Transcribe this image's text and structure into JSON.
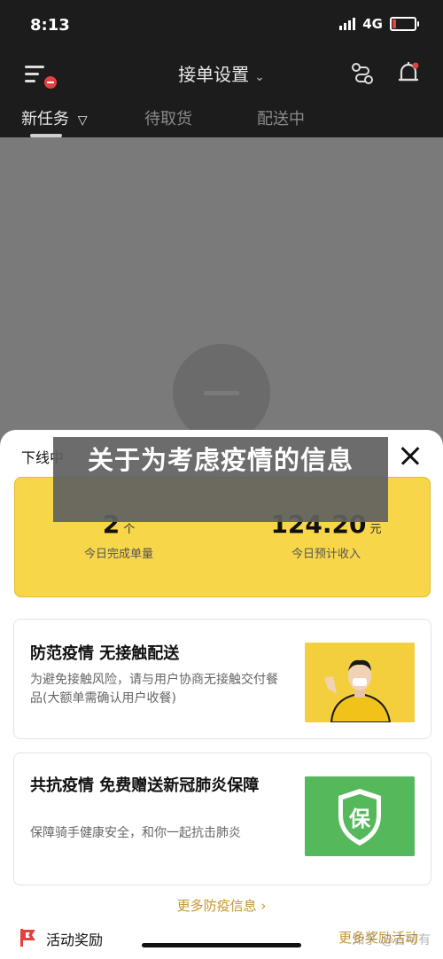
{
  "status_bar": {
    "time": "8:13",
    "network": "4G"
  },
  "header": {
    "title": "接单设置",
    "tabs": [
      "新任务",
      "待取货",
      "配送中"
    ],
    "active_tab": 0
  },
  "sheet": {
    "status_text": "下线中",
    "stats": [
      {
        "value": "2",
        "unit": "个",
        "label": "今日完成单量"
      },
      {
        "value": "124.20",
        "unit": "元",
        "label": "今日预计收入"
      }
    ],
    "promos": [
      {
        "title": "防范疫情 无接触配送",
        "desc": "为避免接触风险，请与用户协商无接触交付餐品(大额单需确认用户收餐)"
      },
      {
        "title": "共抗疫情 免费赠送新冠肺炎保障",
        "desc": "保障骑手健康安全，和你一起抗击肺炎",
        "shield_char": "保"
      }
    ],
    "more_link": "更多防疫信息 ›",
    "activity_label": "活动奖励",
    "activity_more": "更多奖励活动"
  },
  "overlay": {
    "title": "关于为考虑疫情的信息"
  },
  "watermark": "知乎 @吉可有",
  "colors": {
    "accent_yellow": "#f7d64a",
    "link_gold": "#c7942c",
    "shield_green": "#55b95c",
    "alert_red": "#e34040"
  }
}
